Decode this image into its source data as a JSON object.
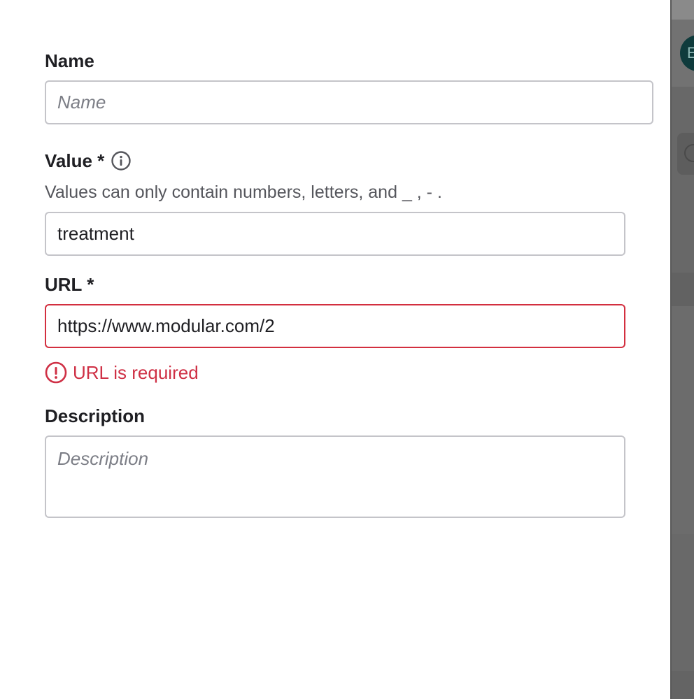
{
  "form": {
    "name": {
      "label": "Name",
      "placeholder": "Name",
      "value": ""
    },
    "value": {
      "label": "Value *",
      "info_icon": "info-icon",
      "hint": "Values can only contain numbers, letters, and _ , - .",
      "value": "treatment"
    },
    "url": {
      "label": "URL *",
      "value": "https://www.modular.com/2",
      "error_icon": "alert-circle-icon",
      "error": "URL is required"
    },
    "description": {
      "label": "Description",
      "placeholder": "Description",
      "value": ""
    }
  },
  "background": {
    "avatar_initial": "E"
  },
  "colors": {
    "error": "#d32f3f",
    "border": "#c4c4c9",
    "text": "#1f1f23",
    "hint": "#55565c",
    "placeholder": "#7c7e86"
  }
}
